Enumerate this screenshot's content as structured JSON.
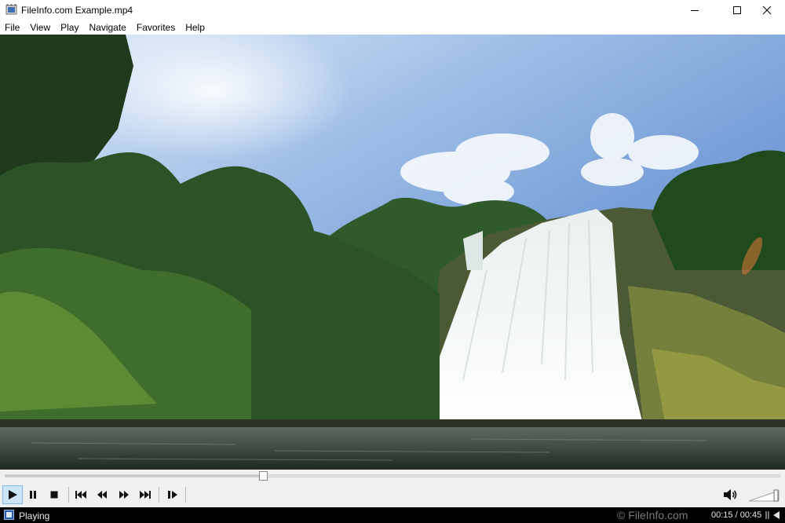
{
  "window": {
    "title": "FileInfo.com Example.mp4",
    "icon": "media-player-app-icon",
    "controls": [
      "minimize-icon",
      "maximize-icon",
      "close-icon"
    ]
  },
  "menu": {
    "items": [
      "File",
      "View",
      "Play",
      "Navigate",
      "Favorites",
      "Help"
    ]
  },
  "playback": {
    "seek_progress": 0.333,
    "buttons": [
      "play-icon",
      "pause-icon",
      "stop-icon",
      "skip-back-icon",
      "rewind-icon",
      "fast-forward-icon",
      "skip-forward-icon",
      "frame-step-icon"
    ],
    "active_button": "play-icon",
    "volume_icon": "speaker-icon"
  },
  "status": {
    "state": "Playing",
    "watermark": "© FileInfo.com",
    "time": "00:15 / 00:45"
  },
  "colors": {
    "status_bar_bg": "#000000",
    "controls_bg": "#f0f0f0",
    "active_button": "#cce4f7"
  }
}
